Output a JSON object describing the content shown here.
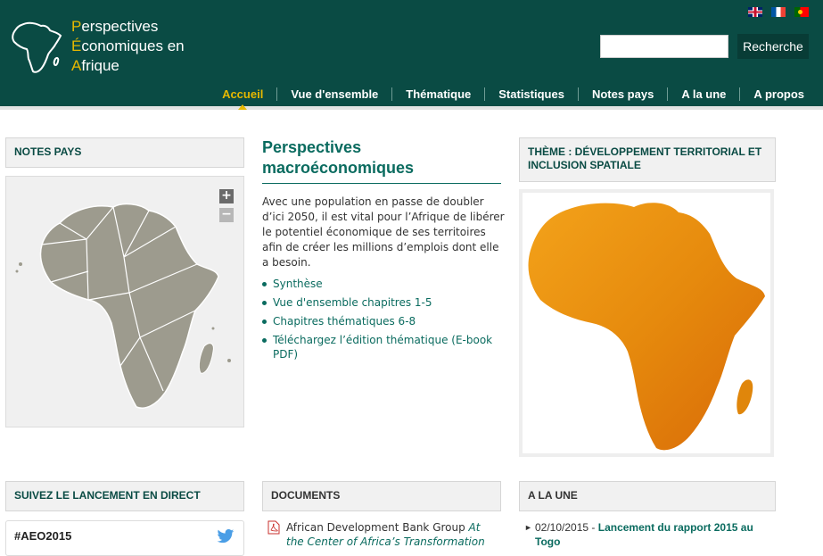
{
  "brand": {
    "line1_initial": "P",
    "line1_rest": "erspectives",
    "line2_initial": "É",
    "line2_rest": "conomiques en",
    "line3_initial": "A",
    "line3_rest": "frique"
  },
  "languages": [
    {
      "name": "uk-flag-icon"
    },
    {
      "name": "fr-flag-icon"
    },
    {
      "name": "pt-flag-icon"
    }
  ],
  "search": {
    "placeholder": "",
    "button_label": "Recherche"
  },
  "nav": {
    "items": [
      "Accueil",
      "Vue d'ensemble",
      "Thématique",
      "Statistiques",
      "Notes pays",
      "A la une",
      "A propos"
    ],
    "active_index": 0
  },
  "notes_pays": {
    "title": "NOTES PAYS",
    "zoom_in": "+",
    "zoom_out": "−"
  },
  "macro": {
    "title": "Perspectives macroéconomiques",
    "intro": "Avec une population en passe de doubler d’ici 2050, il est vital pour l’Afrique de libérer le potentiel économique de ses territoires afin de créer les millions d’emplois dont elle a besoin.",
    "links": [
      "Synthèse",
      "Vue d'ensemble chapitres 1-5",
      "Chapitres thématiques 6-8",
      "Téléchargez l’édition thématique (E-book PDF)"
    ]
  },
  "theme": {
    "title": "THÈME : DÉVELOPPEMENT TERRITORIAL ET INCLUSION SPATIALE"
  },
  "launch": {
    "title": "SUIVEZ LE LANCEMENT EN DIRECT",
    "hashtag": "#AEO2015"
  },
  "documents": {
    "title": "DOCUMENTS",
    "item_prefix": "African Development Bank Group ",
    "item_title": "At the Center of Africa’s Transformation"
  },
  "news": {
    "title": "A LA UNE",
    "date": "02/10/2015 - ",
    "link": "Lancement du rapport 2015 au Togo"
  },
  "colors": {
    "header_bg": "#0a4b44",
    "accent_yellow": "#e6b800",
    "link_green": "#0a6b5f"
  }
}
